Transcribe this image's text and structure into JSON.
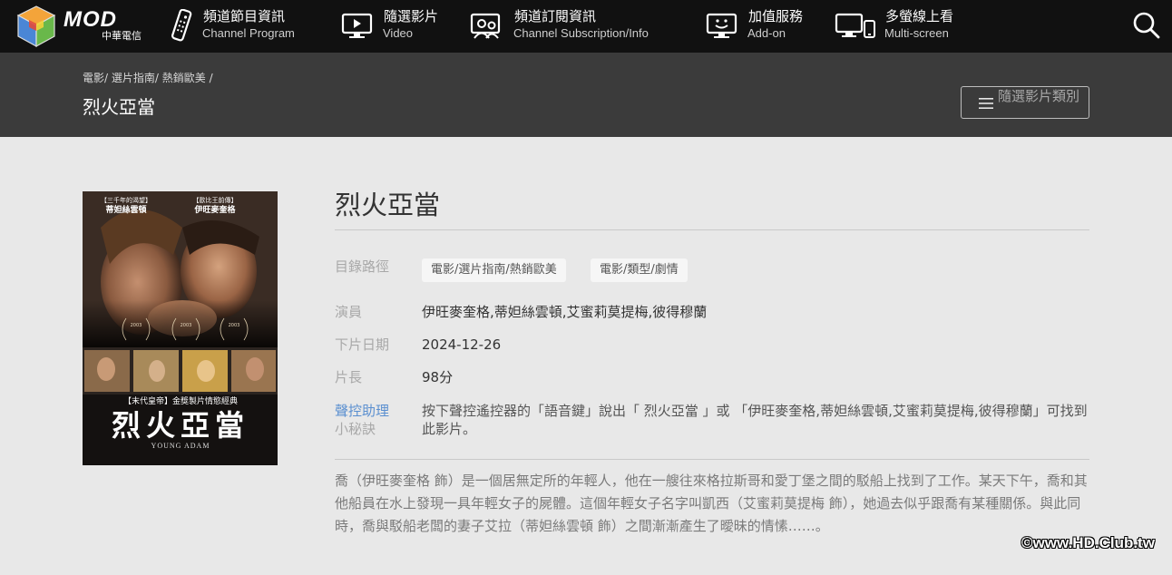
{
  "logo": {
    "brand": "MOD",
    "operator": "中華電信"
  },
  "nav": [
    {
      "zh": "頻道節目資訊",
      "en": "Channel Program",
      "icon": "remote-control-icon"
    },
    {
      "zh": "隨選影片",
      "en": "Video",
      "icon": "video-play-icon"
    },
    {
      "zh": "頻道訂閱資訊",
      "en": "Channel Subscription/Info",
      "icon": "subscription-people-icon"
    },
    {
      "zh": "加值服務",
      "en": "Add-on",
      "icon": "smiley-tv-icon"
    },
    {
      "zh": "多螢線上看",
      "en": "Multi-screen",
      "icon": "multi-screen-icon"
    }
  ],
  "breadcrumb": [
    "電影",
    "選片指南",
    "熱銷歐美"
  ],
  "breadcrumb_sep": "/",
  "page_title": "烈火亞當",
  "category_button": "隨選影片類別",
  "poster": {
    "top_left_tag": "【三千年的渴望】",
    "top_left_name": "蒂妲絲雲頓",
    "top_right_tag": "【歐比王前傳】",
    "top_right_name": "伊旺麥奎格",
    "tagline": "【末代皇帝】金獎製片情慾經典",
    "title": "烈火亞當",
    "title_en": "YOUNG ADAM",
    "award1_year": "2003",
    "award2_year": "2003",
    "award3_year": "2003"
  },
  "detail": {
    "title": "烈火亞當",
    "path_label": "目錄路徑",
    "tags": [
      "電影/選片指南/熱銷歐美",
      "電影/類型/劇情"
    ],
    "cast_label": "演員",
    "cast": "伊旺麥奎格,蒂妲絲雲頓,艾蜜莉莫提梅,彼得穆蘭",
    "offdate_label": "下片日期",
    "offdate": "2024-12-26",
    "length_label": "片長",
    "length": "98分",
    "voice_label": "聲控助理",
    "voice_sub": "小秘訣",
    "voice_text": "按下聲控遙控器的「語音鍵」說出「 烈火亞當 」或 「伊旺麥奎格,蒂妲絲雲頓,艾蜜莉莫提梅,彼得穆蘭」可找到此影片。",
    "synopsis": "喬（伊旺麥奎格 飾）是一個居無定所的年輕人，他在一艘往來格拉斯哥和愛丁堡之間的駁船上找到了工作。某天下午，喬和其他船員在水上發現一具年輕女子的屍體。這個年輕女子名字叫凱西（艾蜜莉莫提梅 飾），她過去似乎跟喬有某種關係。與此同時，喬與駁船老闆的妻子艾拉（蒂妲絲雲頓 飾）之間漸漸產生了曖昧的情愫……。"
  },
  "watermark": "©www.HD.Club.tw"
}
